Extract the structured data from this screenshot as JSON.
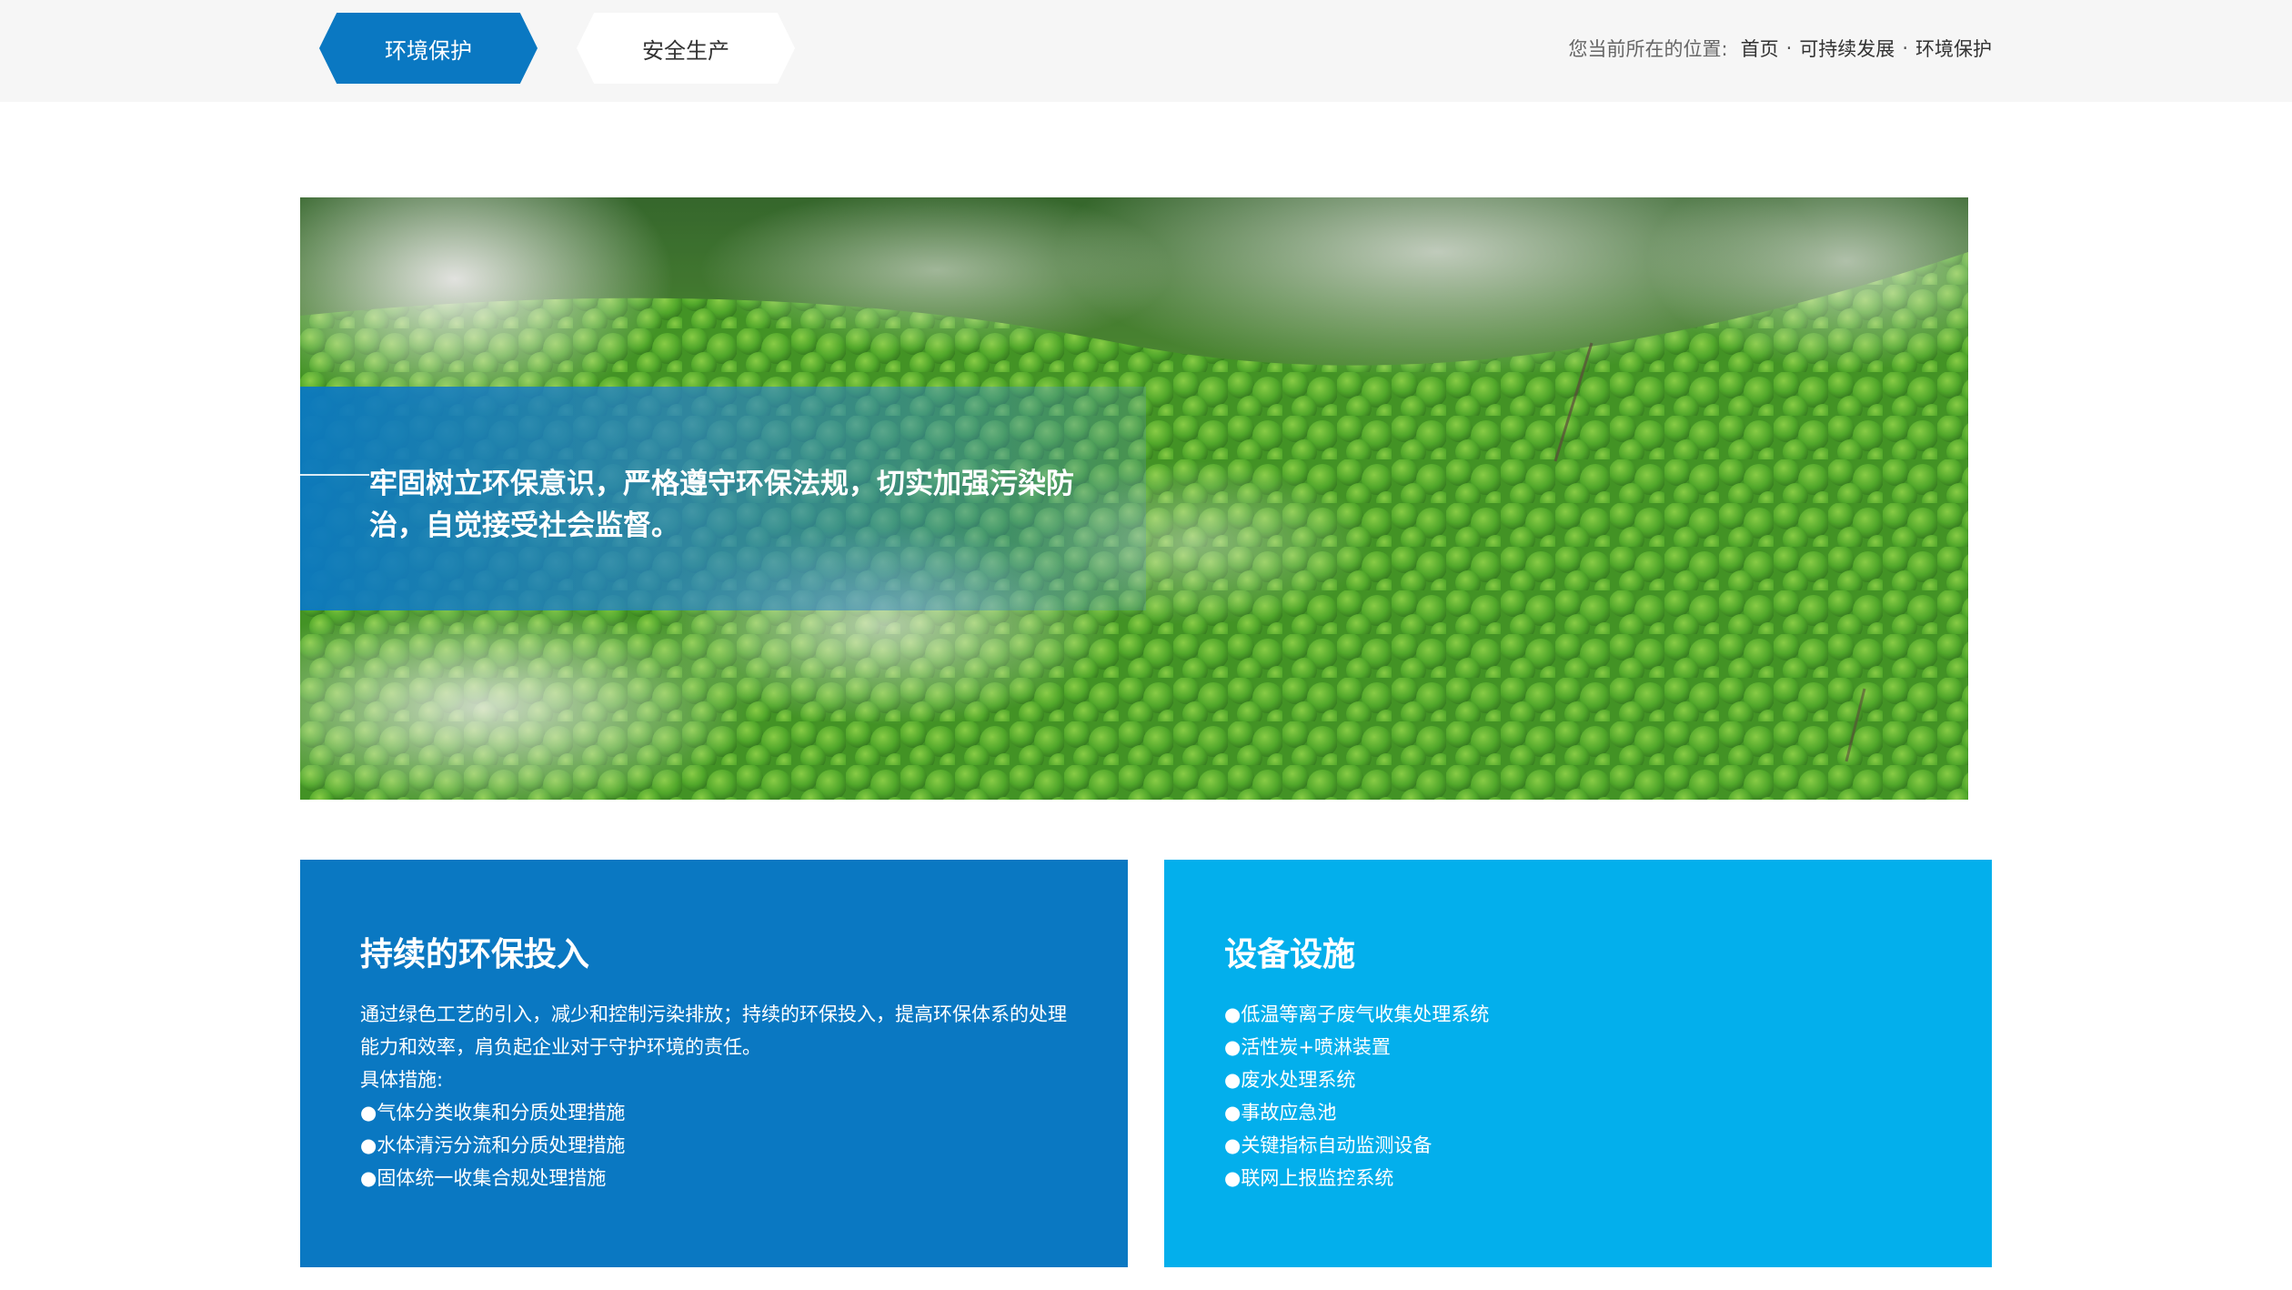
{
  "tabs": [
    {
      "label": "环境保护",
      "active": true
    },
    {
      "label": "安全生产",
      "active": false
    }
  ],
  "breadcrumb": {
    "prefix": "您当前所在的位置:",
    "items": [
      "首页",
      "可持续发展",
      "环境保护"
    ],
    "separator": "·"
  },
  "hero": {
    "slogan": "牢固树立环保意识，严格遵守环保法规，切实加强污染防治，自觉接受社会监督。"
  },
  "cards": [
    {
      "title": "持续的环保投入",
      "description": "通过绿色工艺的引入，减少和控制污染排放；持续的环保投入，提高环保体系的处理能力和效率，肩负起企业对于守护环境的责任。",
      "subheading": "具体措施:",
      "items": [
        "●气体分类收集和分质处理措施",
        "●水体清污分流和分质处理措施",
        "●固体统一收集合规处理措施"
      ]
    },
    {
      "title": "设备设施",
      "items": [
        "●低温等离子废气收集处理系统",
        "●活性炭+喷淋装置",
        "●废水处理系统",
        "●事故应急池",
        "●关键指标自动监测设备",
        "●联网上报监控系统"
      ]
    }
  ],
  "colors": {
    "primary": "#0a78c2",
    "secondary": "#03afec",
    "topbar": "#f6f6f6"
  }
}
